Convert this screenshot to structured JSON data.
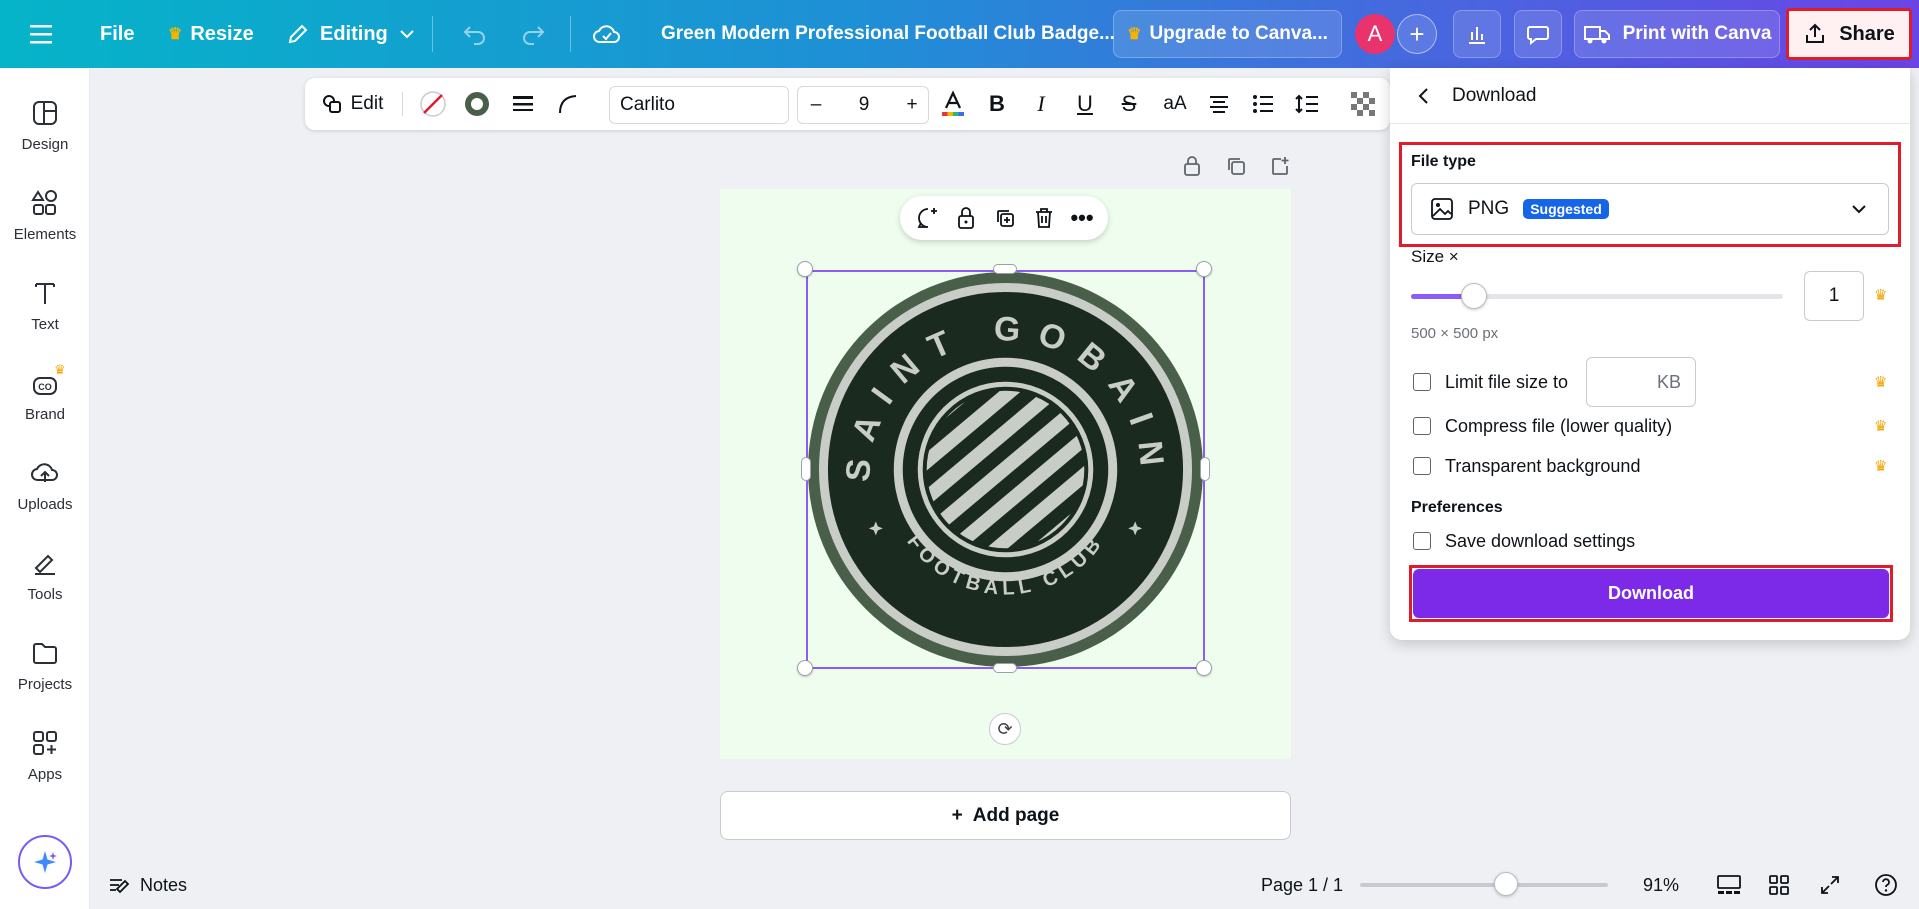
{
  "topbar": {
    "file_label": "File",
    "resize_label": "Resize",
    "editing_label": "Editing",
    "doc_title": "Green Modern Professional Football Club Badge...",
    "upgrade_label": "Upgrade to Canva...",
    "avatar_letter": "A",
    "print_label": "Print with Canva",
    "share_label": "Share"
  },
  "sidebar": {
    "items": [
      {
        "label": "Design",
        "icon": "design-icon"
      },
      {
        "label": "Elements",
        "icon": "elements-icon"
      },
      {
        "label": "Text",
        "icon": "text-icon"
      },
      {
        "label": "Brand",
        "icon": "brand-icon"
      },
      {
        "label": "Uploads",
        "icon": "uploads-icon"
      },
      {
        "label": "Tools",
        "icon": "tools-icon"
      },
      {
        "label": "Projects",
        "icon": "projects-icon"
      },
      {
        "label": "Apps",
        "icon": "apps-icon"
      }
    ]
  },
  "toolbar": {
    "edit_label": "Edit",
    "font_name": "Carlito",
    "font_size": "9",
    "minus": "–",
    "plus": "+",
    "case_label": "aA"
  },
  "badge": {
    "arc_text": "SAINT GOBAIN",
    "bottom_text": "FOOTBALL CLUB",
    "colors": {
      "ring": "#4a5f4a",
      "inner": "#1b2a1e",
      "light": "#c9cdc7"
    }
  },
  "canvas": {
    "add_page_label": "Add page",
    "background": "#eefdee"
  },
  "bottombar": {
    "notes_label": "Notes",
    "page_indicator": "Page 1 / 1",
    "zoom_label": "91%",
    "zoom_fraction": 0.59
  },
  "download_panel": {
    "title": "Download",
    "file_type_label": "File type",
    "file_type_value": "PNG",
    "suggested_badge": "Suggested",
    "size_label": "Size ×",
    "size_value": "1",
    "size_fraction": 0.17,
    "dimensions": "500 × 500 px",
    "limit_label": "Limit file size to",
    "kb_placeholder": "KB",
    "compress_label": "Compress file (lower quality)",
    "transparent_label": "Transparent background",
    "preferences_label": "Preferences",
    "save_settings_label": "Save download settings",
    "download_button": "Download"
  },
  "accent_colors": {
    "purple": "#7d2ae8",
    "highlight_red": "#e01b2b",
    "badge_blue": "#1565e8"
  }
}
